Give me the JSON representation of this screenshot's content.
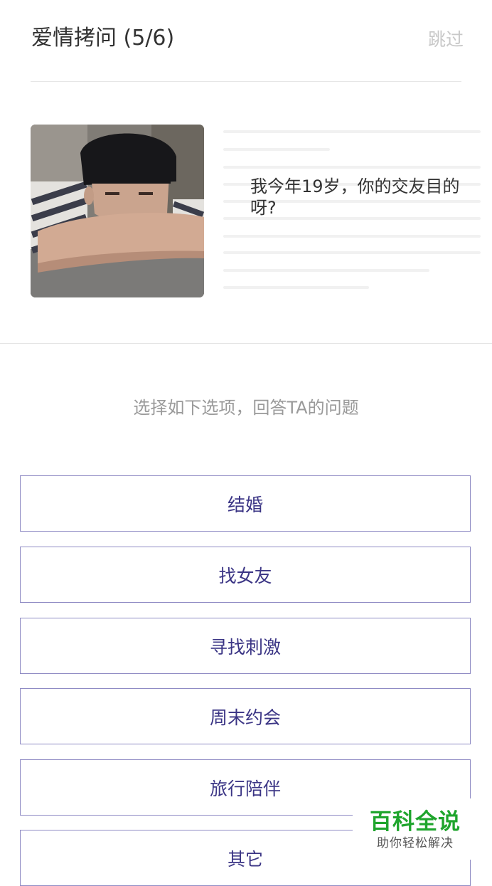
{
  "header": {
    "title": "爱情拷问 (5/6)",
    "skip_label": "跳过"
  },
  "question": {
    "text": "我今年19岁，你的交友目的呀?"
  },
  "prompt": "选择如下选项，回答TA的问题",
  "options": [
    {
      "label": "结婚"
    },
    {
      "label": "找女友"
    },
    {
      "label": "寻找刺激"
    },
    {
      "label": "周末约会"
    },
    {
      "label": "旅行陪伴"
    },
    {
      "label": "其它"
    }
  ],
  "watermark": {
    "main": "百科全说",
    "sub": "助你轻松解决"
  },
  "colors": {
    "accent_text": "#3b3585",
    "option_border": "#8f8bc4",
    "watermark_green": "#1fa52d"
  }
}
